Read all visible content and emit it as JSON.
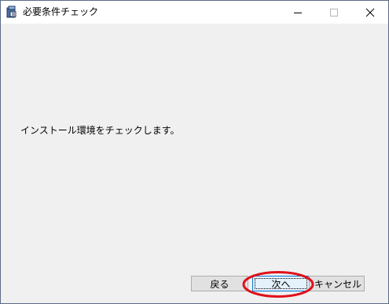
{
  "window": {
    "title": "必要条件チェック",
    "icon": "installer-icon"
  },
  "controls": {
    "minimize_icon": "minimize-icon",
    "maximize_icon": "maximize-icon",
    "close_icon": "close-icon"
  },
  "content": {
    "message": "インストール環境をチェックします。"
  },
  "buttons": {
    "back_label": "戻る",
    "next_label": "次へ",
    "cancel_label": "キャンセル"
  },
  "annotation": {
    "highlight_color": "#e0101a"
  }
}
